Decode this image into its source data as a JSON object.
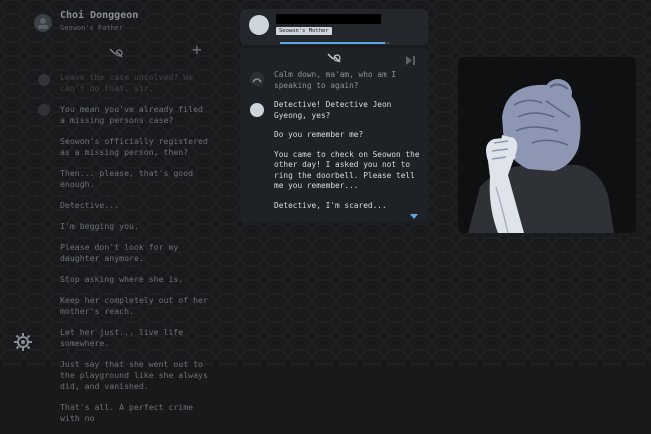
{
  "left": {
    "contact_name": "Choi Donggeon",
    "contact_role": "Seowon's Father",
    "messages": [
      "Leave the case unsolved? We can't do that, sir.",
      "You mean you've already filed a missing persons case?",
      "Seowon's officially registered as a missing person, then?",
      "Then... please, that's good enough.",
      "Detective...",
      "I'm begging you.",
      "Please don't look for my daughter anymore.",
      "Stop asking where she is.",
      "Keep her completely out of her mother's reach.",
      "Let her just... live life somewhere.",
      "Just say that she went out to the playground like she always did, and vanished.",
      "That's all. A perfect crime with no"
    ],
    "icons": {
      "link": "link-icon",
      "add": "plus-icon",
      "settings": "gear-icon"
    }
  },
  "chat": {
    "contact_role": "Seowon's Mother",
    "progress": 0.95,
    "messages": [
      {
        "text": "Calm down, ma'am, who am I speaking to again?",
        "from": "detective"
      },
      {
        "text": "Detective! Detective Jeon Gyeong, yes?",
        "from": "mother"
      },
      {
        "text": "Do you remember me?",
        "from": "mother"
      },
      {
        "text": "You came to check on Seowon the other day! I asked you not to ring the doorbell. Please tell me you remember...",
        "from": "mother"
      },
      {
        "text": "Detective, I'm scared...",
        "from": "mother"
      }
    ],
    "icons": {
      "link": "link-icon",
      "skip": "skip-icon",
      "scroll": "scroll-down-icon"
    }
  },
  "colors": {
    "accent": "#5fa8e8",
    "portrait_hair": "#8d97b3",
    "portrait_bg": "#0f1012"
  }
}
